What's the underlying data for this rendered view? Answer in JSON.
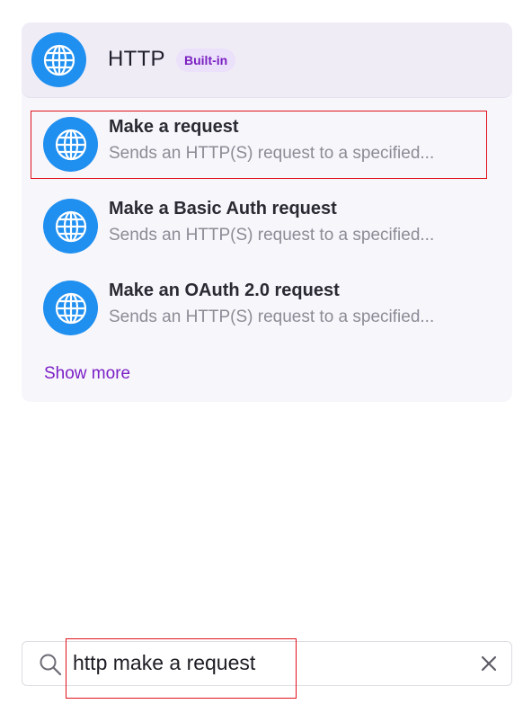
{
  "app": {
    "name": "HTTP",
    "badge": "Built-in",
    "icon": "globe-icon",
    "accent_color": "#1f8ff0",
    "badge_color": "#7a1fc2"
  },
  "modules": [
    {
      "title": "Make a request",
      "description": "Sends an HTTP(S) request to a specified...",
      "icon": "globe-icon"
    },
    {
      "title": "Make a Basic Auth request",
      "description": "Sends an HTTP(S) request to a specified...",
      "icon": "globe-icon"
    },
    {
      "title": "Make an OAuth 2.0 request",
      "description": "Sends an HTTP(S) request to a specified...",
      "icon": "globe-icon"
    }
  ],
  "show_more_label": "Show more",
  "search": {
    "value": "http make a request",
    "icon": "search-icon",
    "clear_icon": "close-icon"
  },
  "highlight_color": "#e0121a"
}
